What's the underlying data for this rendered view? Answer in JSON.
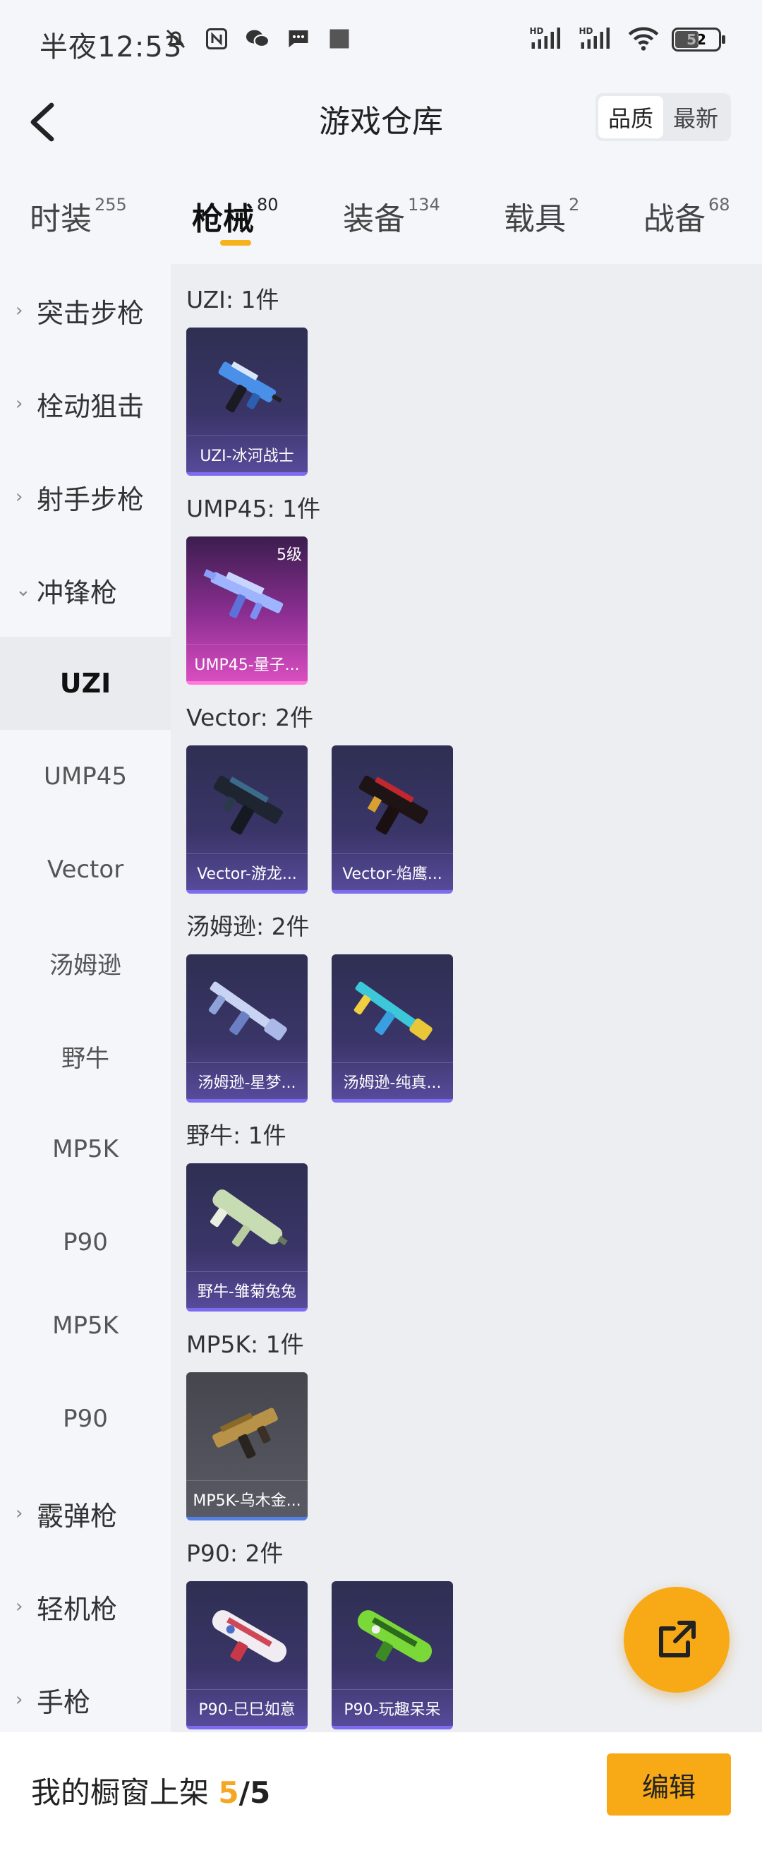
{
  "status_bar": {
    "time": "半夜12:53",
    "left_icons": [
      "mute-bell-icon",
      "nfc-icon",
      "wechat-icon",
      "message-icon",
      "app-square-icon"
    ],
    "right_icons": [
      "hd-signal-icon",
      "hd-signal-icon",
      "wifi-icon"
    ],
    "battery": "52"
  },
  "header": {
    "title": "游戏仓库",
    "sort_options": [
      "品质",
      "最新"
    ],
    "active_sort": "品质"
  },
  "tabs": [
    {
      "label": "时装",
      "count": "255"
    },
    {
      "label": "枪械",
      "count": "80"
    },
    {
      "label": "装备",
      "count": "134"
    },
    {
      "label": "载具",
      "count": "2"
    },
    {
      "label": "战备",
      "count": "68"
    }
  ],
  "active_tab": "枪械",
  "sidenav": [
    {
      "label": "突击步枪",
      "type": "category"
    },
    {
      "label": "栓动狙击",
      "type": "category"
    },
    {
      "label": "射手步枪",
      "type": "category"
    },
    {
      "label": "冲锋枪",
      "type": "category",
      "expanded": true
    },
    {
      "label": "UZI",
      "type": "sub",
      "active": true
    },
    {
      "label": "UMP45",
      "type": "sub"
    },
    {
      "label": "Vector",
      "type": "sub"
    },
    {
      "label": "汤姆逊",
      "type": "sub"
    },
    {
      "label": "野牛",
      "type": "sub"
    },
    {
      "label": "MP5K",
      "type": "sub"
    },
    {
      "label": "P90",
      "type": "sub"
    },
    {
      "label": "MP5K",
      "type": "sub"
    },
    {
      "label": "P90",
      "type": "sub"
    },
    {
      "label": "霰弹枪",
      "type": "category"
    },
    {
      "label": "轻机枪",
      "type": "category"
    },
    {
      "label": "手枪",
      "type": "category"
    }
  ],
  "groups": [
    {
      "title": "UZI: 1件",
      "items": [
        {
          "name": "UZI-冰河战士",
          "style": "purple",
          "level": ""
        }
      ]
    },
    {
      "title": "UMP45: 1件",
      "items": [
        {
          "name": "UMP45-量子...",
          "style": "pink",
          "level": "5级"
        }
      ]
    },
    {
      "title": "Vector: 2件",
      "items": [
        {
          "name": "Vector-游龙...",
          "style": "purple",
          "level": ""
        },
        {
          "name": "Vector-焰鹰...",
          "style": "purple",
          "level": ""
        }
      ]
    },
    {
      "title": "汤姆逊: 2件",
      "items": [
        {
          "name": "汤姆逊-星梦...",
          "style": "purple",
          "level": ""
        },
        {
          "name": "汤姆逊-纯真...",
          "style": "purple",
          "level": ""
        }
      ]
    },
    {
      "title": "野牛: 1件",
      "items": [
        {
          "name": "野牛-雏菊兔兔",
          "style": "purple",
          "level": ""
        }
      ]
    },
    {
      "title": "MP5K: 1件",
      "items": [
        {
          "name": "MP5K-乌木金...",
          "style": "gray",
          "level": ""
        }
      ]
    },
    {
      "title": "P90: 2件",
      "items": [
        {
          "name": "P90-巳巳如意",
          "style": "purple",
          "level": ""
        },
        {
          "name": "P90-玩趣呆呆",
          "style": "purple",
          "level": ""
        }
      ]
    }
  ],
  "bottom_bar": {
    "label": "我的橱窗上架",
    "count": "5",
    "separator": "/",
    "total": "5",
    "edit_label": "编辑"
  },
  "colors": {
    "accent": "#f7a916",
    "tab_underline": "#f5b21b",
    "count_highlight": "#f5a623"
  }
}
